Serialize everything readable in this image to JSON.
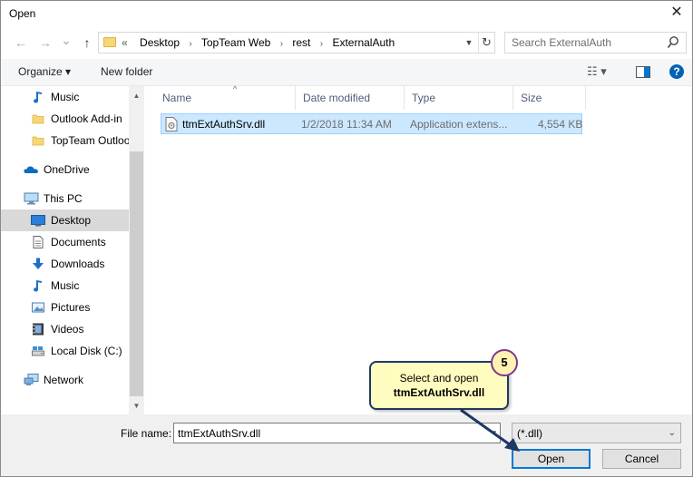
{
  "window": {
    "title": "Open",
    "close_glyph": "✕"
  },
  "nav": {
    "back_glyph": "←",
    "forward_glyph": "→",
    "recent_glyph": "⌄",
    "up_glyph": "↑",
    "overflow_glyph": "«",
    "breadcrumbs": [
      "Desktop",
      "TopTeam Web",
      "rest",
      "ExternalAuth"
    ],
    "crumb_separator": "›",
    "address_dropdown_glyph": "▼",
    "refresh_glyph": "↻",
    "search_placeholder": "Search ExternalAuth"
  },
  "toolbar": {
    "organize_label": "Organize ▾",
    "new_folder_label": "New folder",
    "view_glyph": "☷ ▾",
    "help_glyph": "?"
  },
  "sidebar": {
    "items": [
      {
        "label": "Music",
        "icon": "music-icon",
        "indent": 2
      },
      {
        "label": "Outlook Add-in",
        "icon": "folder-icon",
        "indent": 2
      },
      {
        "label": "TopTeam Outlook Add-in",
        "icon": "folder-icon",
        "indent": 2
      },
      {
        "label": "OneDrive",
        "icon": "cloud-icon",
        "indent": 1
      },
      {
        "label": "This PC",
        "icon": "computer-icon",
        "indent": 1
      },
      {
        "label": "Desktop",
        "icon": "desktop-icon",
        "indent": 2,
        "selected": true
      },
      {
        "label": "Documents",
        "icon": "documents-icon",
        "indent": 2
      },
      {
        "label": "Downloads",
        "icon": "downloads-icon",
        "indent": 2
      },
      {
        "label": "Music",
        "icon": "music-icon",
        "indent": 2
      },
      {
        "label": "Pictures",
        "icon": "pictures-icon",
        "indent": 2
      },
      {
        "label": "Videos",
        "icon": "videos-icon",
        "indent": 2
      },
      {
        "label": "Local Disk (C:)",
        "icon": "drive-icon",
        "indent": 2
      },
      {
        "label": "Network",
        "icon": "network-icon",
        "indent": 1
      }
    ],
    "scroll_up_glyph": "▲",
    "scroll_down_glyph": "▼"
  },
  "columns": {
    "name": "Name",
    "date": "Date modified",
    "type": "Type",
    "size": "Size",
    "sort_glyph": "^"
  },
  "files": [
    {
      "name": "ttmExtAuthSrv.dll",
      "date": "1/2/2018 11:34 AM",
      "type": "Application extens...",
      "size": "4,554 KB"
    }
  ],
  "bottom": {
    "file_name_label": "File name:",
    "file_name_value": "ttmExtAuthSrv.dll",
    "file_name_dropdown_glyph": "▾",
    "filter_value": "(*.dll)",
    "filter_dropdown_glyph": "⌄",
    "open_label": "Open",
    "cancel_label": "Cancel"
  },
  "callout": {
    "line1": "Select and open",
    "line2": "ttmExtAuthSrv.dll",
    "step": "5"
  },
  "colors": {
    "accent": "#0078d7",
    "selection": "#cce8ff",
    "callout_fill": "#fffcbf",
    "callout_border": "#1f3864",
    "badge_border": "#7a3b8f"
  }
}
